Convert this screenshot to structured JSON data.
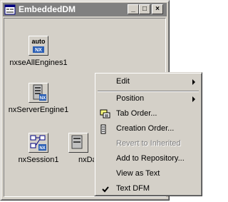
{
  "window": {
    "title": "EmbeddedDM",
    "buttons": {
      "minimize": "_",
      "maximize": "□",
      "close": "×"
    },
    "icons": {
      "title": "delphi-form-icon"
    }
  },
  "components": [
    {
      "name": "nxseAllEngines1",
      "icon": "nxse-all-engines-icon",
      "badge": "auto"
    },
    {
      "name": "nxServerEngine1",
      "icon": "nx-server-engine-icon"
    },
    {
      "name": "nxSession1",
      "icon": "nx-session-icon"
    },
    {
      "name": "nxDa",
      "icon": "nx-database-icon"
    }
  ],
  "context_menu": {
    "items": [
      {
        "label": "Edit",
        "submenu": true
      },
      {
        "label": "Position",
        "submenu": true
      },
      {
        "label": "Tab Order...",
        "icon": "tab-order-icon"
      },
      {
        "label": "Creation Order..."
      },
      {
        "label": "Revert to Inherited",
        "disabled": true
      },
      {
        "label": "Add to Repository..."
      },
      {
        "label": "View as Text"
      },
      {
        "label": "Text DFM",
        "checked": true
      }
    ]
  }
}
